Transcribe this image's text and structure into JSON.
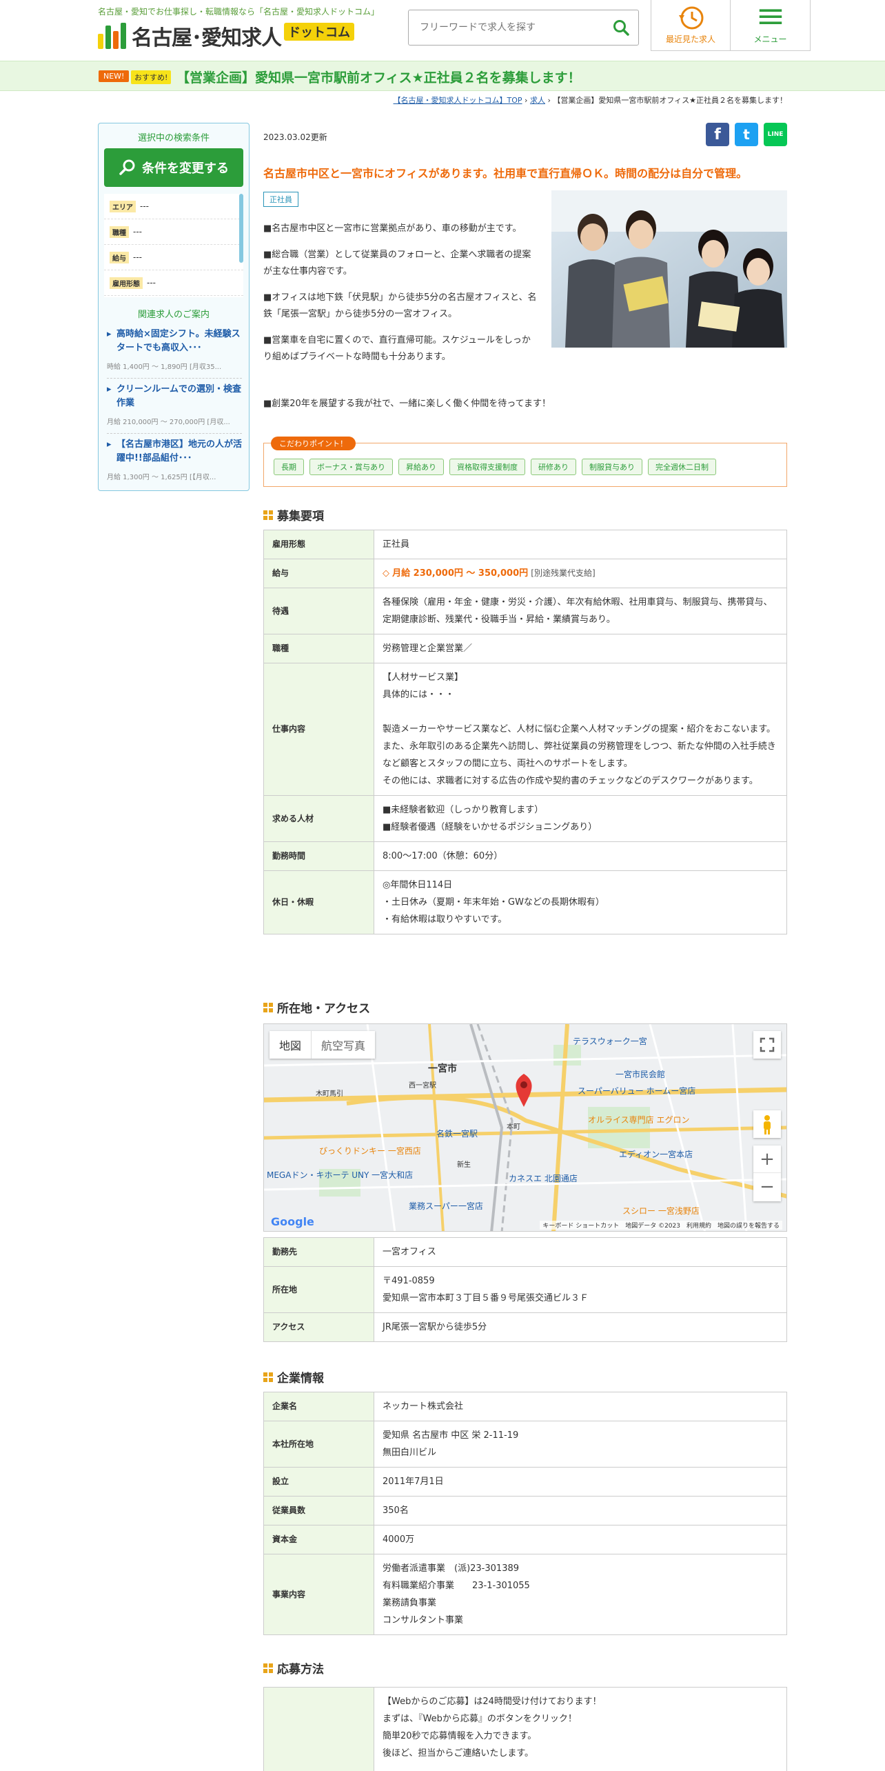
{
  "header": {
    "tagline": "名古屋・愛知でお仕事探し・転職情報なら「名古屋・愛知求人ドットコム」",
    "logo_text": "名古屋･愛知求人",
    "logo_dotcom": "ドットコム",
    "search_placeholder": "フリーワードで求人を探す",
    "recent_label": "最近見た求人",
    "menu_label": "メニュー"
  },
  "banner": {
    "new_badge": "NEW!",
    "osusume_badge": "おすすめ!",
    "title": "【営業企画】愛知県一宮市駅前オフィス★正社員２名を募集します！"
  },
  "breadcrumb": {
    "home": "【名古屋・愛知求人ドットコム】TOP",
    "sep1": "›",
    "jobs": "求人",
    "sep2": "›",
    "current": "【営業企画】愛知県一宮市駅前オフィス★正社員２名を募集します！"
  },
  "sidebar": {
    "heading": "選択中の検索条件",
    "change_button": "条件を変更する",
    "filters": [
      {
        "tag": "エリア",
        "value": "---"
      },
      {
        "tag": "職種",
        "value": "---"
      },
      {
        "tag": "給与",
        "value": "---"
      },
      {
        "tag": "雇用形態",
        "value": "---"
      }
    ],
    "related_heading": "関連求人のご案内",
    "related": [
      {
        "title": "高時給×固定シフト。未経験スタートでも高収入･･･",
        "sub": "時給 1,400円 ～ 1,890円 [月収35..."
      },
      {
        "title": "クリーンルームでの選別・検査作業",
        "sub": "月給 210,000円 ～ 270,000円 [月収..."
      },
      {
        "title": "【名古屋市港区】地元の人が活躍中!!部品組付･･･",
        "sub": "月給 1,300円 ～ 1,625円 [【月収..."
      }
    ]
  },
  "main": {
    "date": "2023.03.02更新",
    "share": {
      "facebook": "f",
      "twitter": "t",
      "line": "LINE"
    },
    "lead": "名古屋市中区と一宮市にオフィスがあります。社用車で直行直帰ＯＫ。時間の配分は自分で管理。",
    "employment_tag": "正社員",
    "intro": [
      "■名古屋市中区と一宮市に営業拠点があり、車の移動が主です。",
      "■総合職（営業）として従業員のフォローと、企業へ求職者の提案が主な仕事内容です。",
      "■オフィスは地下鉄「伏見駅」から徒歩5分の名古屋オフィスと、名鉄「尾張一宮駅」から徒歩5分の一宮オフィス。",
      "■営業車を自宅に置くので、直行直帰可能。スケジュールをしっかり組めばプライベートな時間も十分あります。"
    ],
    "intro_last": "■創業20年を展望する我が社で、一緒に楽しく働く仲間を待ってます！",
    "points_label": "こだわりポイント！",
    "points": [
      "長期",
      "ボーナス・賞与あり",
      "昇給あり",
      "資格取得支援制度",
      "研修あり",
      "制服貸与あり",
      "完全週休二日制"
    ]
  },
  "recruit": {
    "title": "募集要項",
    "employment": {
      "label": "雇用形態",
      "value": "正社員"
    },
    "salary": {
      "label": "給与",
      "prefix": "◇",
      "value": "月給 230,000円 ～ 350,000円",
      "note": "[別途残業代支給]"
    },
    "benefits": {
      "label": "待遇",
      "value": "各種保険（雇用・年金・健康・労災・介護）、年次有給休暇、社用車貸与、制服貸与、携帯貸与、定期健康診断、残業代・役職手当・昇給・業績賞与あり。"
    },
    "occupation": {
      "label": "職種",
      "value": "労務管理と企業営業／"
    },
    "work": {
      "label": "仕事内容",
      "lines": [
        "【人材サービス業】",
        "具体的には・・・",
        "",
        "製造メーカーやサービス業など、人材に悩む企業へ人材マッチングの提案・紹介をおこないます。",
        "また、永年取引のある企業先へ訪問し、弊社従業員の労務管理をしつつ、新たな仲間の入社手続きなど顧客とスタッフの間に立ち、両社へのサポートをします。",
        "その他には、求職者に対する広告の作成や契約書のチェックなどのデスクワークがあります。"
      ]
    },
    "requirements": {
      "label": "求める人材",
      "lines": [
        "■未経験者歓迎（しっかり教育します）",
        "■経験者優遇（経験をいかせるポジショニングあり）"
      ]
    },
    "hours": {
      "label": "勤務時間",
      "value": "8:00～17:00（休憩：60分）"
    },
    "holidays": {
      "label": "休日・休暇",
      "lines": [
        "◎年間休日114日",
        "・土日休み（夏期・年末年始・GWなどの長期休暇有）",
        "・有給休暇は取りやすいです。"
      ]
    }
  },
  "access": {
    "title": "所在地・アクセス",
    "map": {
      "tab_map": "地図",
      "tab_aerial": "航空写真",
      "footer": "キーボード ショートカット　地図データ ©2023　利用規約　地図の誤りを報告する",
      "google": "Google",
      "labels": [
        "一宮市",
        "テラスウォーク一宮",
        "一宮市民会館",
        "スーパーバリュー ホームー宮店",
        "オルライス専門店 エグロン",
        "名鉄一宮駅",
        "びっくりドンキー 一宮西店",
        "MEGAドン・キホーテ UNY 一宮大和店",
        "カネスエ 北園通店",
        "エディオン一宮本店",
        "業務スーパー一宮店",
        "スシロー 一宮浅野店",
        "本町",
        "新生",
        "木町馬引",
        "西一宮駅"
      ]
    },
    "workplace": {
      "label": "勤務先",
      "value": "一宮オフィス"
    },
    "address": {
      "label": "所在地",
      "lines": [
        "〒491-0859",
        "愛知県一宮市本町３丁目５番９号尾張交通ビル３Ｆ"
      ]
    },
    "access": {
      "label": "アクセス",
      "value": "JR尾張一宮駅から徒歩5分"
    }
  },
  "company": {
    "title": "企業情報",
    "name": {
      "label": "企業名",
      "value": "ネッカート株式会社"
    },
    "hq": {
      "label": "本社所在地",
      "lines": [
        "愛知県 名古屋市 中区 栄 2-11-19",
        "無田白川ビル"
      ]
    },
    "founded": {
      "label": "設立",
      "value": "2011年7月1日"
    },
    "employees": {
      "label": "従業員数",
      "value": "350名"
    },
    "capital": {
      "label": "資本金",
      "value": "4000万"
    },
    "business": {
      "label": "事業内容",
      "lines": [
        "労働者派遣事業　(派)23-301389",
        "有料職業紹介事業　　23-1-301055",
        "業務請負事業",
        "コンサルタント事業"
      ]
    }
  },
  "apply": {
    "title": "応募方法",
    "lines": [
      "【Webからのご応募】は24時間受け付けております！",
      "まずは、『Webから応募』のボタンをクリック！",
      "簡単20秒で応募情報を入力できます。",
      "後ほど、担当からご連絡いたします。"
    ]
  },
  "colors": {
    "green": "#2c9d3a",
    "orange": "#ee6a0b",
    "blue": "#1e5ca8",
    "th_bg": "#eef8e6"
  }
}
